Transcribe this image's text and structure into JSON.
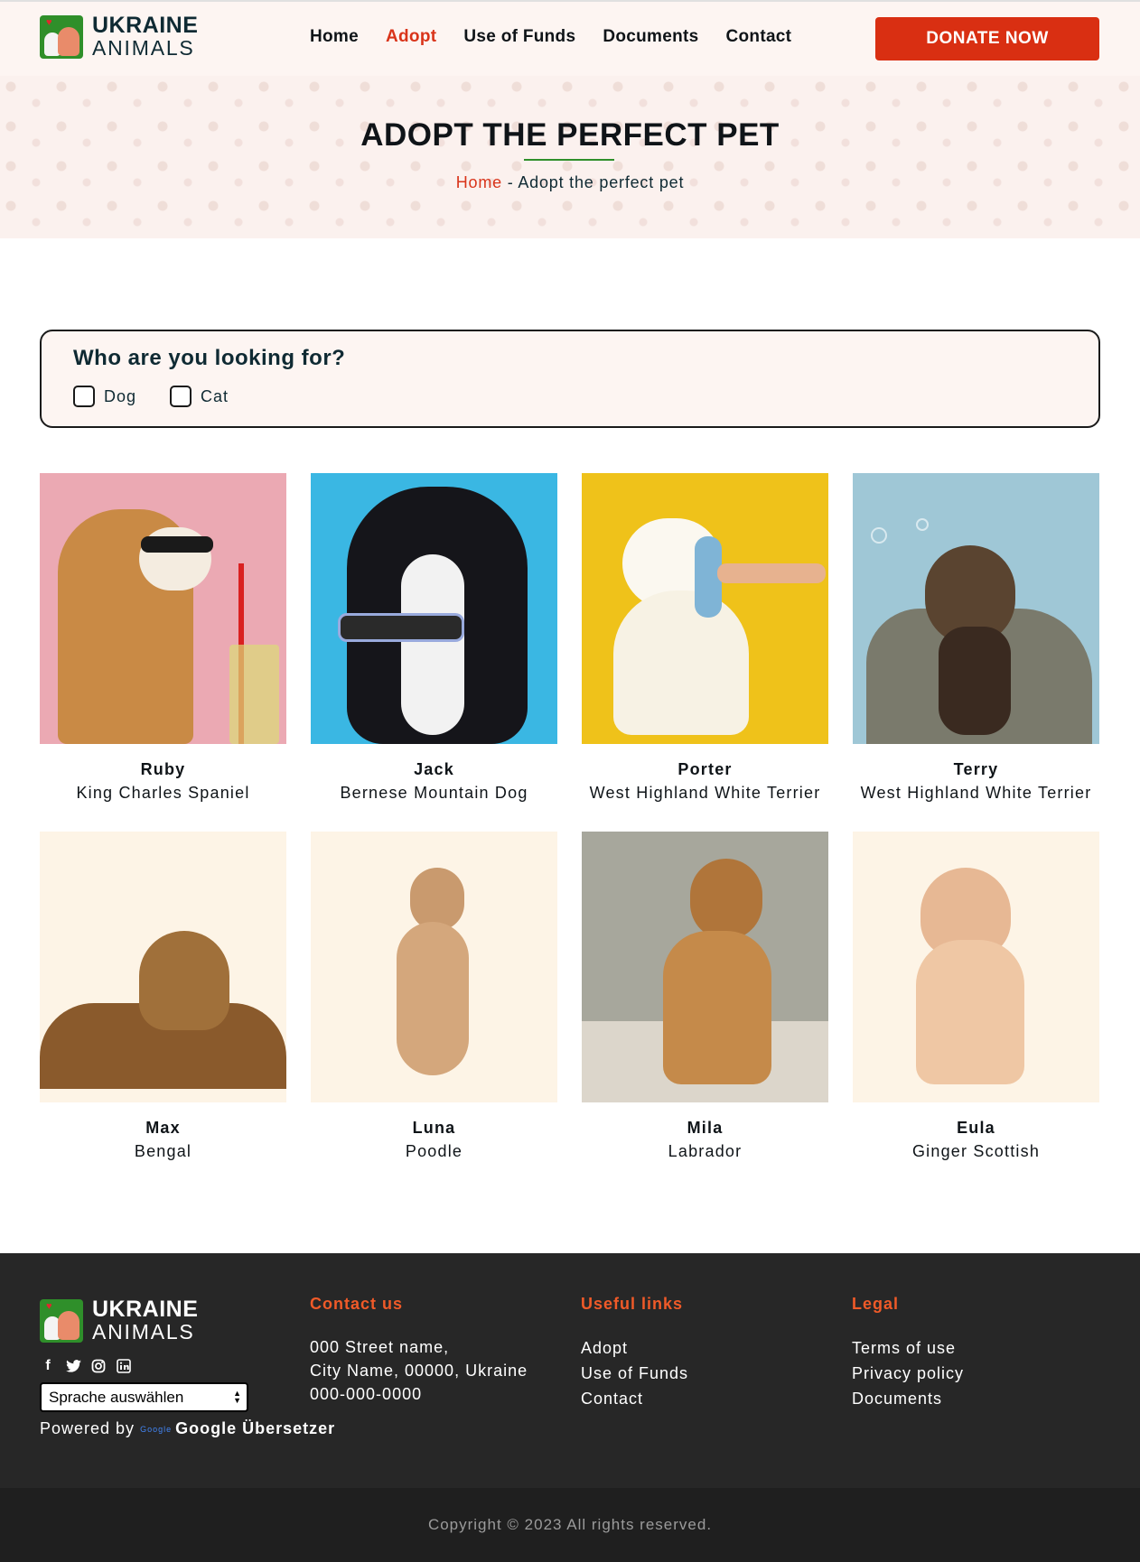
{
  "brand": {
    "line1": "UKRAINE",
    "line2": "ANIMALS"
  },
  "nav": [
    {
      "label": "Home",
      "active": false
    },
    {
      "label": "Adopt",
      "active": true
    },
    {
      "label": "Use of Funds",
      "active": false
    },
    {
      "label": "Documents",
      "active": false
    },
    {
      "label": "Contact",
      "active": false
    }
  ],
  "donate_label": "DONATE NOW",
  "hero": {
    "title": "ADOPT THE PERFECT PET",
    "breadcrumb_home": "Home",
    "breadcrumb_sep": " - ",
    "breadcrumb_current": "Adopt the perfect pet"
  },
  "filter": {
    "title": "Who are you looking for?",
    "options": [
      "Dog",
      "Cat"
    ]
  },
  "pets": [
    {
      "name": "Ruby",
      "breed": "King Charles Spaniel"
    },
    {
      "name": "Jack",
      "breed": "Bernese Mountain Dog"
    },
    {
      "name": "Porter",
      "breed": "West Highland White Terrier"
    },
    {
      "name": "Terry",
      "breed": "West Highland White Terrier"
    },
    {
      "name": "Max",
      "breed": "Bengal"
    },
    {
      "name": "Luna",
      "breed": "Poodle"
    },
    {
      "name": "Mila",
      "breed": "Labrador"
    },
    {
      "name": "Eula",
      "breed": "Ginger Scottish"
    }
  ],
  "footer": {
    "language_select": "Sprache auswählen",
    "powered_by": "Powered by",
    "google_small": "Google",
    "translator": "Google Übersetzer",
    "contact": {
      "heading": "Contact us",
      "address1": "000 Street name,",
      "address2": "City Name, 00000, Ukraine",
      "phone": "000-000-0000"
    },
    "useful": {
      "heading": "Useful links",
      "links": [
        "Adopt",
        "Use of Funds",
        "Contact"
      ]
    },
    "legal": {
      "heading": "Legal",
      "links": [
        "Terms of use",
        "Privacy policy",
        "Documents"
      ]
    },
    "social_icons": [
      "facebook-icon",
      "twitter-icon",
      "instagram-icon",
      "linkedin-icon"
    ]
  },
  "copyright": "Copyright © 2023 All rights reserved.",
  "colors": {
    "accent": "#d92f12",
    "brand_green": "#2f8f2a",
    "footer_heading": "#f05a28"
  }
}
